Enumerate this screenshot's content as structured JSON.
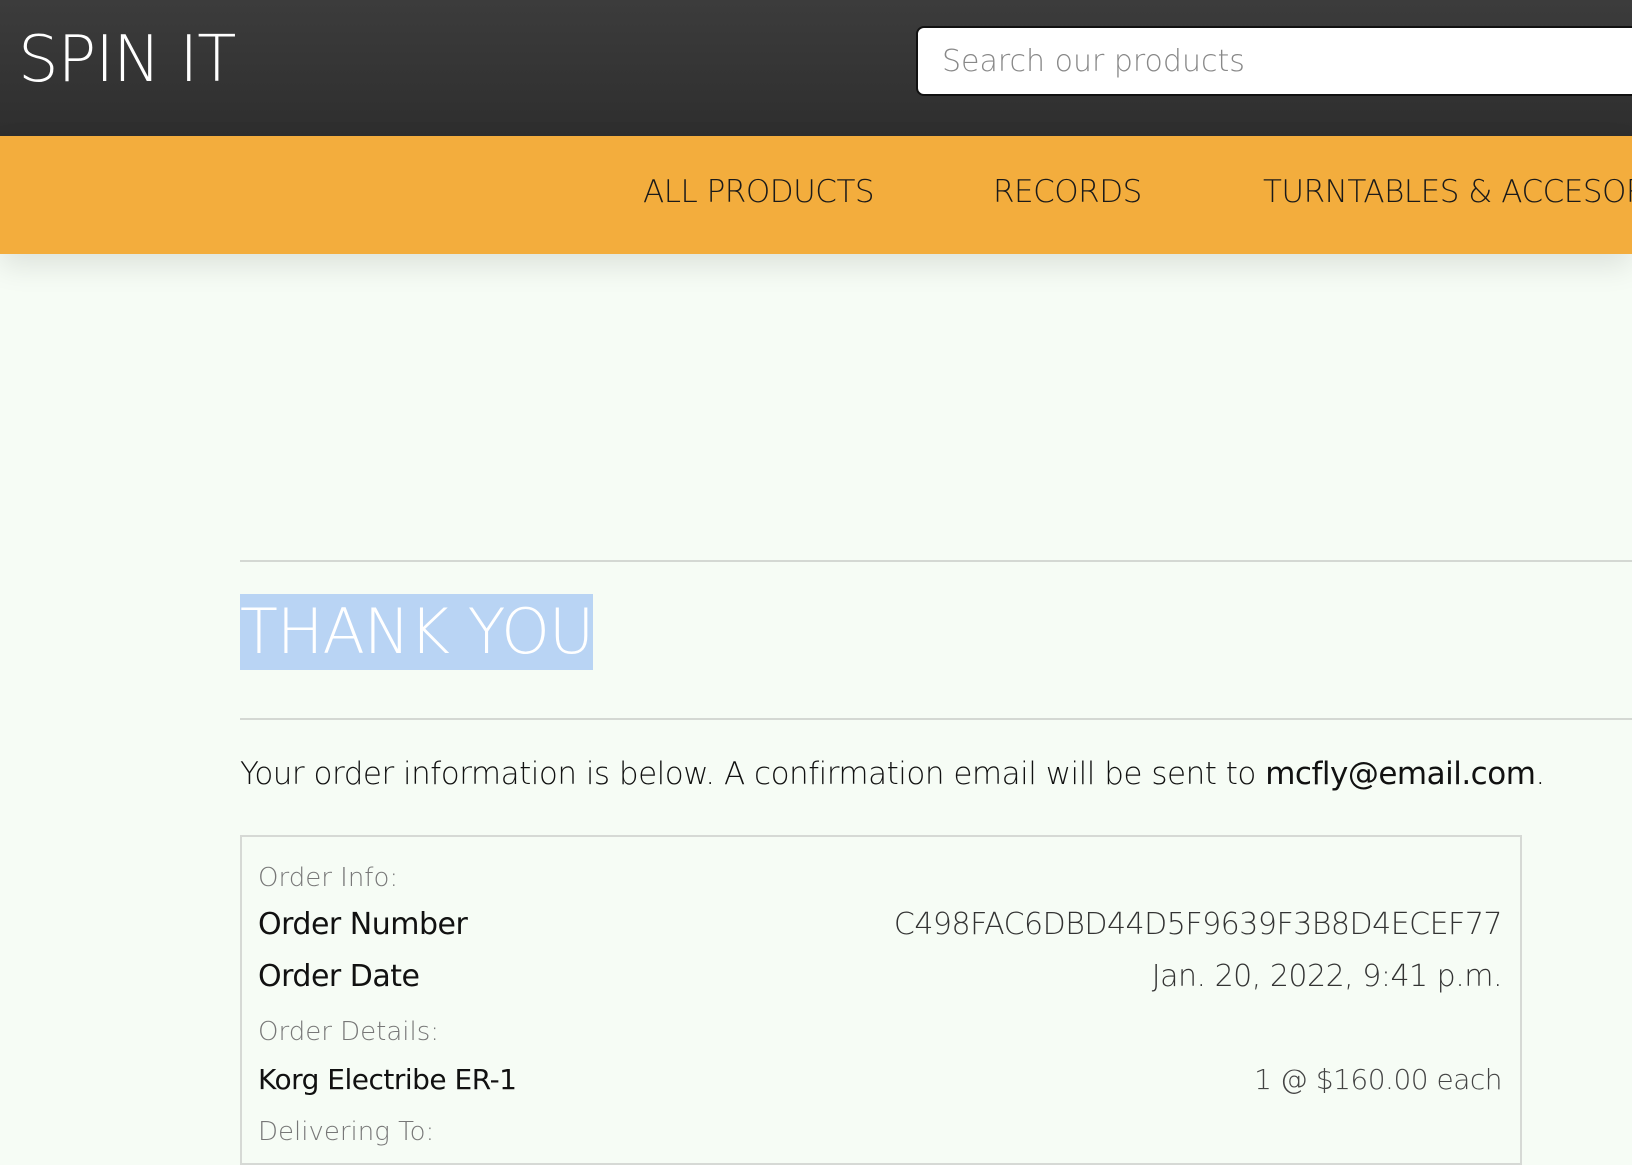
{
  "header": {
    "logo": "SPIN IT",
    "search_placeholder": "Search our products"
  },
  "nav": {
    "items": [
      {
        "label": "ALL PRODUCTS"
      },
      {
        "label": "RECORDS"
      },
      {
        "label": "TURNTABLES & ACCESOR"
      }
    ]
  },
  "colors": {
    "topbar": "#333333",
    "navbar": "#f3ad3d",
    "page_background": "#f6fcf5",
    "selection_highlight": "#b9d4f4"
  },
  "confirmation": {
    "heading": "THANK YOU",
    "intro_text": "Your order information is below. A confirmation email will be sent to ",
    "email": "mcfly@email.com",
    "intro_suffix": "."
  },
  "order": {
    "info_label": "Order Info:",
    "number_label": "Order Number",
    "number_value": "C498FAC6DBD44D5F9639F3B8D4ECEF77",
    "date_label": "Order Date",
    "date_value": "Jan. 20, 2022, 9:41 p.m.",
    "details_label": "Order Details:",
    "items": [
      {
        "name": "Korg Electribe ER-1",
        "quantity_price": "1 @ $160.00 each"
      }
    ],
    "delivering_label": "Delivering To:"
  }
}
